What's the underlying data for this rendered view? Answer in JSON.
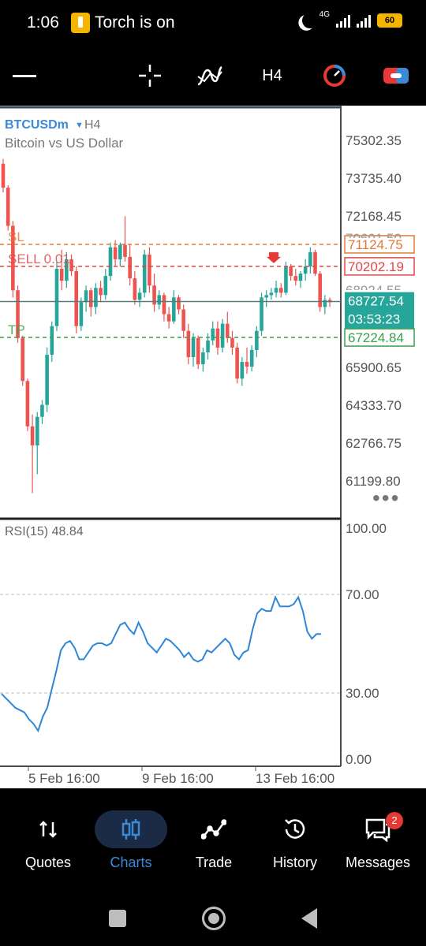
{
  "status_bar": {
    "time": "1:06",
    "notification": "Torch is on",
    "network": "4G",
    "battery": "60"
  },
  "toolbar": {
    "menu_icon": "hamburger-icon",
    "crosshair_icon": "crosshair-icon",
    "indicators_icon": "indicators-icon",
    "timeframe": "H4",
    "trading_icon": "one-click-trading-icon",
    "toggle_icon": "toggle-icon"
  },
  "chart": {
    "symbol": "BTCUSDm",
    "timeframe": "H4",
    "description": "Bitcoin vs US Dollar",
    "price_scale": [
      "75302.35",
      "73735.40",
      "72168.45",
      "65900.65",
      "64333.70",
      "62766.75",
      "61199.80"
    ],
    "partial_label": "70601.50",
    "partial_label_2": "68924.55",
    "sl": {
      "label": "SL",
      "price": "71124.75",
      "color": "#e07b39"
    },
    "sell": {
      "label": "SELL 0.01",
      "price": "70202.19",
      "color": "#e04848"
    },
    "tp": {
      "label": "TP",
      "price": "67224.84",
      "color": "#3aa04a"
    },
    "current": {
      "price": "68727.54",
      "countdown": "03:53:23",
      "color": "#26a69a"
    },
    "more_icon": "more-icon",
    "candle_colors": {
      "up": "#26a69a",
      "down": "#ef5350"
    }
  },
  "rsi": {
    "label": "RSI(15) 48.84",
    "scale": [
      "100.00",
      "70.00",
      "30.00",
      "0.00"
    ]
  },
  "time_axis": [
    "5 Feb 16:00",
    "9 Feb 16:00",
    "13 Feb 16:00"
  ],
  "chart_data": {
    "type": "line",
    "candles": [
      [
        74500,
        74700,
        73300,
        73500
      ],
      [
        73500,
        73600,
        71700,
        71900
      ],
      [
        71900,
        72100,
        68900,
        69200
      ],
      [
        69200,
        69400,
        67000,
        67200
      ],
      [
        67200,
        67300,
        65200,
        65400
      ],
      [
        65400,
        65500,
        63300,
        63500
      ],
      [
        63500,
        64000,
        60700,
        62700
      ],
      [
        62700,
        64100,
        61500,
        63900
      ],
      [
        63900,
        64600,
        63600,
        64400
      ],
      [
        64400,
        66800,
        64100,
        66500
      ],
      [
        66500,
        67900,
        66200,
        67700
      ],
      [
        67700,
        70400,
        67500,
        70100
      ],
      [
        70100,
        70900,
        69200,
        69600
      ],
      [
        69600,
        70800,
        69300,
        70500
      ],
      [
        70500,
        70700,
        69800,
        70000
      ],
      [
        70000,
        70200,
        67400,
        67700
      ],
      [
        67700,
        68900,
        67500,
        68700
      ],
      [
        68700,
        69400,
        68300,
        69200
      ],
      [
        69200,
        69300,
        68100,
        68500
      ],
      [
        68500,
        69500,
        68200,
        69300
      ],
      [
        69300,
        69600,
        68700,
        69000
      ],
      [
        69000,
        70100,
        68800,
        69800
      ],
      [
        69800,
        71200,
        69600,
        71000
      ],
      [
        71000,
        71300,
        70200,
        70500
      ],
      [
        70500,
        71200,
        70200,
        71100
      ],
      [
        71100,
        72300,
        70400,
        70600
      ],
      [
        70600,
        71100,
        69400,
        69700
      ],
      [
        69700,
        70000,
        68600,
        68800
      ],
      [
        68800,
        69300,
        68500,
        69100
      ],
      [
        69100,
        70900,
        68900,
        70700
      ],
      [
        70700,
        71000,
        69100,
        69400
      ],
      [
        69400,
        69900,
        68300,
        68600
      ],
      [
        68600,
        69200,
        68400,
        69000
      ],
      [
        69000,
        69100,
        67900,
        68200
      ],
      [
        68200,
        68500,
        67600,
        67900
      ],
      [
        67900,
        69200,
        67800,
        68900
      ],
      [
        68900,
        69000,
        68200,
        68400
      ],
      [
        68400,
        68600,
        67200,
        67500
      ],
      [
        67500,
        67800,
        66100,
        66400
      ],
      [
        66400,
        67400,
        66000,
        67200
      ],
      [
        67200,
        67300,
        65900,
        66100
      ],
      [
        66100,
        66800,
        65800,
        66600
      ],
      [
        66600,
        67400,
        66300,
        67100
      ],
      [
        67100,
        67900,
        66900,
        67600
      ],
      [
        67600,
        67900,
        66500,
        66800
      ],
      [
        66800,
        68000,
        66600,
        67800
      ],
      [
        67800,
        68300,
        67000,
        67200
      ],
      [
        67200,
        67500,
        66500,
        66800
      ],
      [
        66800,
        67000,
        65300,
        65500
      ],
      [
        65500,
        66400,
        65200,
        66200
      ],
      [
        66200,
        66800,
        65700,
        66000
      ],
      [
        66000,
        66900,
        65800,
        66700
      ],
      [
        66700,
        67700,
        66400,
        67500
      ],
      [
        67500,
        69100,
        67300,
        68900
      ],
      [
        68900,
        69200,
        68500,
        69000
      ],
      [
        69000,
        69300,
        68800,
        69100
      ],
      [
        69100,
        69600,
        68900,
        69300
      ],
      [
        69300,
        69500,
        68900,
        69100
      ],
      [
        69100,
        70400,
        69000,
        70200
      ],
      [
        70200,
        70300,
        69600,
        69800
      ],
      [
        69800,
        70100,
        69400,
        69600
      ],
      [
        69600,
        70000,
        69300,
        69900
      ],
      [
        69900,
        70500,
        69600,
        70200
      ],
      [
        70200,
        71000,
        69900,
        70800
      ],
      [
        70800,
        70900,
        69800,
        69900
      ],
      [
        69900,
        70000,
        68300,
        68500
      ],
      [
        68500,
        69000,
        68200,
        68800
      ],
      [
        68800,
        68900,
        68500,
        68700
      ]
    ],
    "rsi_values": [
      28,
      26,
      24,
      22,
      21,
      20,
      17,
      15,
      12,
      18,
      22,
      30,
      38,
      47,
      50,
      51,
      48,
      43,
      43,
      46,
      49,
      50,
      50,
      49,
      50,
      54,
      58,
      59,
      56,
      54,
      59,
      55,
      50,
      48,
      46,
      49,
      52,
      51,
      49,
      47,
      44,
      46,
      43,
      42,
      43,
      47,
      46,
      48,
      50,
      52,
      50,
      45,
      43,
      46,
      47,
      56,
      63,
      65,
      64,
      64,
      70,
      66,
      66,
      66,
      67,
      70,
      64,
      55,
      52,
      54,
      54
    ],
    "ylim": [
      59632,
      76869
    ],
    "rsi_ylim": [
      0,
      100
    ]
  },
  "bottom_nav": [
    {
      "label": "Quotes",
      "icon": "quotes-icon",
      "active": false
    },
    {
      "label": "Charts",
      "icon": "charts-icon",
      "active": true
    },
    {
      "label": "Trade",
      "icon": "trade-icon",
      "active": false
    },
    {
      "label": "History",
      "icon": "history-icon",
      "active": false
    },
    {
      "label": "Messages",
      "icon": "messages-icon",
      "active": false,
      "badge": "2"
    }
  ]
}
